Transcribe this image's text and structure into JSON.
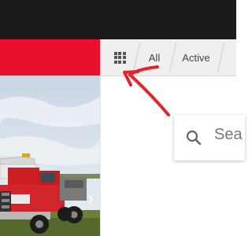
{
  "tabs": {
    "apps_icon": "grid-icon",
    "all_label": "All",
    "active_label": "Active"
  },
  "search": {
    "placeholder": "Sea"
  },
  "carousel": {
    "next_icon": "chevron-right-icon"
  },
  "colors": {
    "topbar": "#1b1b1b",
    "brand_red": "#e8112d",
    "annotation_arrow": "#e2242b"
  }
}
